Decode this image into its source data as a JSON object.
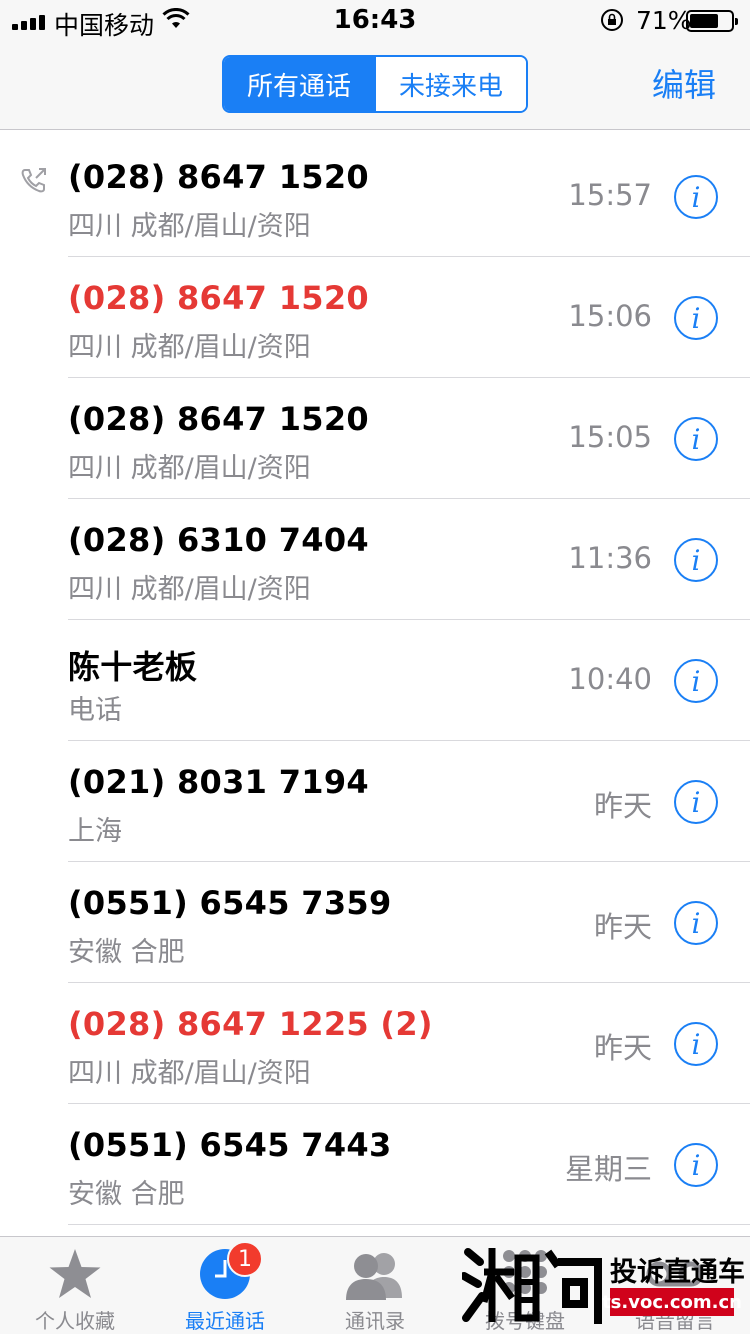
{
  "status_bar": {
    "carrier": "中国移动",
    "time": "16:43",
    "battery": "71%"
  },
  "nav": {
    "segments": [
      "所有通话",
      "未接来电"
    ],
    "edit": "编辑"
  },
  "calls": [
    {
      "name": "(028) 8647 1520",
      "sub": "四川 成都/眉山/资阳",
      "time": "15:57",
      "missed": false,
      "outgoing": true
    },
    {
      "name": "(028) 8647 1520",
      "sub": "四川 成都/眉山/资阳",
      "time": "15:06",
      "missed": true,
      "outgoing": false
    },
    {
      "name": "(028) 8647 1520",
      "sub": "四川 成都/眉山/资阳",
      "time": "15:05",
      "missed": false,
      "outgoing": false
    },
    {
      "name": "(028) 6310 7404",
      "sub": "四川 成都/眉山/资阳",
      "time": "11:36",
      "missed": false,
      "outgoing": false
    },
    {
      "name": "陈十老板",
      "sub": "电话",
      "time": "10:40",
      "missed": false,
      "outgoing": false
    },
    {
      "name": "(021) 8031 7194",
      "sub": "上海",
      "time": "昨天",
      "missed": false,
      "outgoing": false
    },
    {
      "name": "(0551) 6545 7359",
      "sub": "安徽 合肥",
      "time": "昨天",
      "missed": false,
      "outgoing": false
    },
    {
      "name": "(028) 8647 1225 (2)",
      "sub": "四川 成都/眉山/资阳",
      "time": "昨天",
      "missed": true,
      "outgoing": false
    },
    {
      "name": "(0551) 6545 7443",
      "sub": "安徽 合肥",
      "time": "星期三",
      "missed": false,
      "outgoing": false
    }
  ],
  "info_glyph": "i",
  "tabs": [
    {
      "label": "个人收藏",
      "icon": "star-icon"
    },
    {
      "label": "最近通话",
      "icon": "clock-icon",
      "badge": "1",
      "active": true
    },
    {
      "label": "通讯录",
      "icon": "contacts-icon"
    },
    {
      "label": "拨号键盘",
      "icon": "keypad-icon"
    },
    {
      "label": "语音留言",
      "icon": "voicemail-icon"
    }
  ],
  "watermark": {
    "logo": "湘问",
    "title": "投诉直通车",
    "url": "ts.voc.com.cn"
  },
  "colors": {
    "accent": "#1a7ff5",
    "missed": "#e53935",
    "secondary_text": "#8a8a8f",
    "badge": "#f23b2d"
  }
}
